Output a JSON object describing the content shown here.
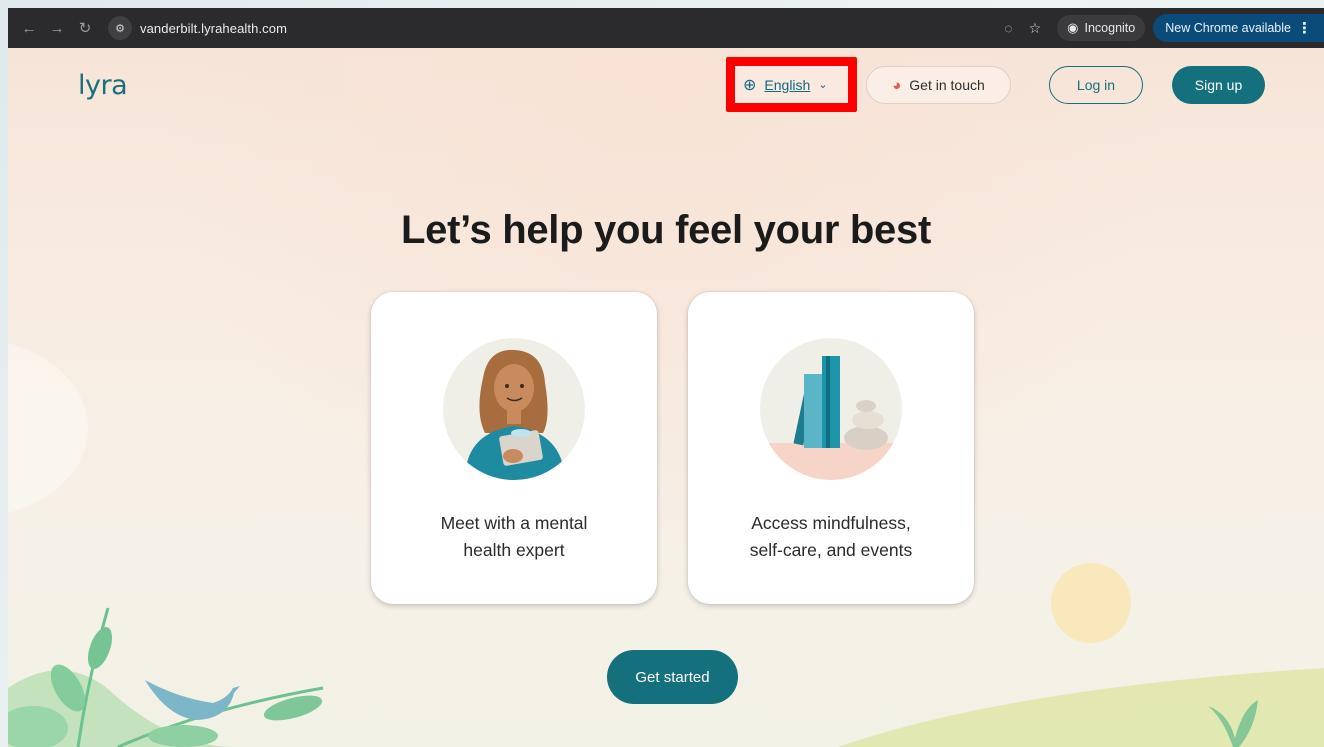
{
  "browser": {
    "back_icon": "arrow-left-icon",
    "forward_icon": "arrow-right-icon",
    "reload_icon": "reload-icon",
    "url": "vanderbilt.lyrahealth.com",
    "incognito_label": "Incognito",
    "update_label": "New Chrome available"
  },
  "header": {
    "logo": "lyra",
    "language": "English",
    "contact_label": "Get in touch",
    "login_label": "Log in",
    "signup_label": "Sign up"
  },
  "main": {
    "headline": "Let’s help you feel your best",
    "cards": [
      {
        "label_line1": "Meet with a mental",
        "label_line2": "health expert",
        "illustration": "person-illustration"
      },
      {
        "label_line1": "Access mindfulness,",
        "label_line2": "self-care, and events",
        "illustration": "books-stones-illustration"
      }
    ],
    "cta_label": "Get started"
  },
  "colors": {
    "brand_teal": "#13707c",
    "highlight_red": "#ff0000",
    "chrome_dark": "#2b2b2d"
  }
}
